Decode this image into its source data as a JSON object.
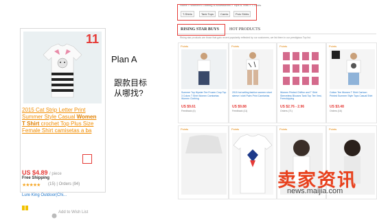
{
  "left_card": {
    "rank": "11",
    "title_a": "2015 Cat Strip Letter Print Summer Style Casual ",
    "title_bold": "Women T Shirt",
    "title_b": " crochet Top Plus Size Female Shirt ",
    "title_c": "camisetas a ba",
    "price": "US $4.89",
    "price_unit": "/ piece",
    "shipping": "Free Shipping",
    "stars": "★★★★★",
    "reviews": "(15) | Orders (94)",
    "store": "Lure King Outdoor(Chi...",
    "wishlist": "Add to Wish List"
  },
  "notes": {
    "plan": "Plan A",
    "line1": "跟款目标",
    "line2": "从哪找?"
  },
  "storefront": {
    "breadcrumb": "Home > Women's Clothing & Accessories > Tops & Tees > T-Shirts",
    "categories": [
      "T-Shirts",
      "Tank Tops",
      "Camis",
      "Polo Shirts"
    ],
    "tabs": [
      "RISING STAR BUYS",
      "HOT PRODUCTS"
    ],
    "description": "Rising star products are those that gain recent popularity reflected by our customers, we list them in our prestigious Top list.",
    "tiles": [
      {
        "label": "Points",
        "title": "Summer Top Hipster Tee Frozen Crop Top 3 Colors T Shirt Women Camisetas Women Clothing",
        "price": "US $9.61",
        "feedback": "Feedback (4)"
      },
      {
        "label": "Points",
        "title": "2015 hot selling fashion women short sleeve t shirt Palm Print Camisetas",
        "price": "US $9.88",
        "feedback": "Feedback (11)"
      },
      {
        "label": "Points",
        "title": "Women Printed Chiffon and T Shirt Sleeveless Blouses Tank Top Tee Vest, Freeshipping",
        "price": "US $2.76 - 2.96",
        "feedback": "Orders (71)"
      },
      {
        "label": "Points",
        "title": "Cotton Tee Women T Shirt Cartoon Printed Summer Style Tops Casual Shirt",
        "price": "US $3.48",
        "feedback": "Orders (16)"
      }
    ],
    "second_row_label": "Points"
  },
  "watermark": {
    "title": "卖家资讯",
    "url": "news.maijia.com"
  }
}
